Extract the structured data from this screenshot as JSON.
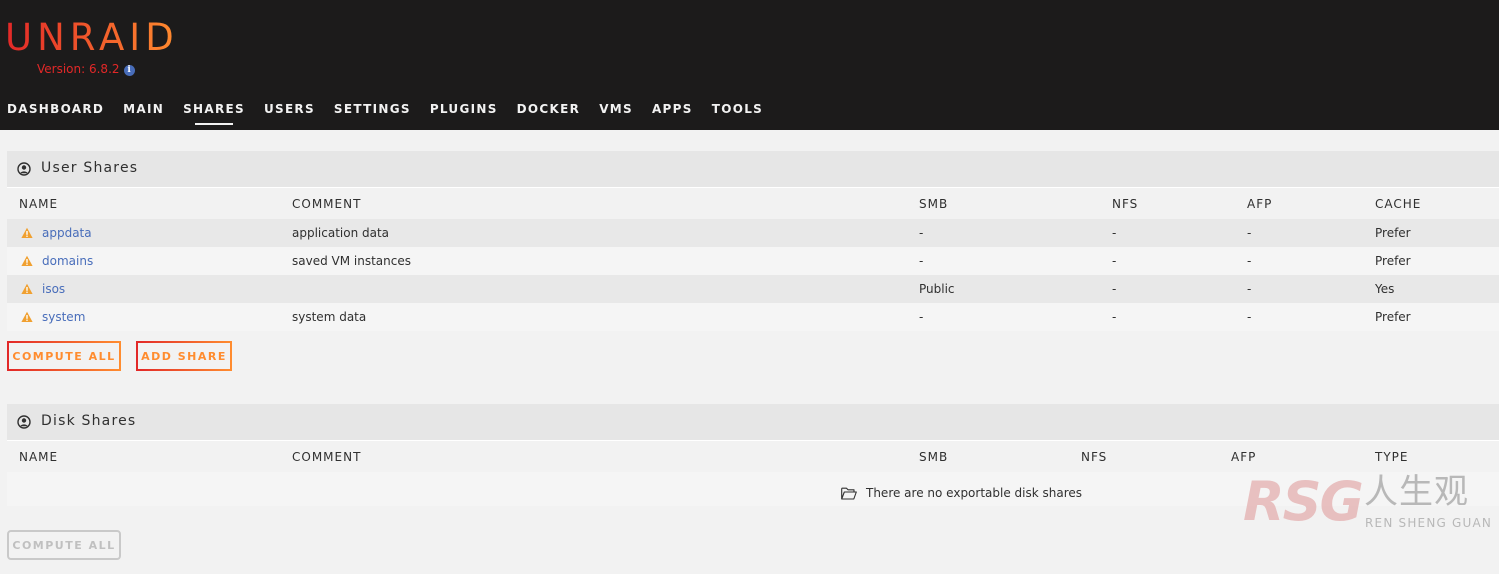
{
  "header": {
    "logo_text": "UNRAID",
    "version_text": "Version: 6.8.2",
    "info_icon": "i"
  },
  "nav": {
    "items": [
      "DASHBOARD",
      "MAIN",
      "SHARES",
      "USERS",
      "SETTINGS",
      "PLUGINS",
      "DOCKER",
      "VMS",
      "APPS",
      "TOOLS"
    ],
    "active": "SHARES"
  },
  "user_shares": {
    "title": "User Shares",
    "columns": [
      "NAME",
      "COMMENT",
      "SMB",
      "NFS",
      "AFP",
      "CACHE"
    ],
    "rows": [
      {
        "name": "appdata",
        "comment": "application data",
        "smb": "-",
        "nfs": "-",
        "afp": "-",
        "cache": "Prefer"
      },
      {
        "name": "domains",
        "comment": "saved VM instances",
        "smb": "-",
        "nfs": "-",
        "afp": "-",
        "cache": "Prefer"
      },
      {
        "name": "isos",
        "comment": "",
        "smb": "Public",
        "nfs": "-",
        "afp": "-",
        "cache": "Yes"
      },
      {
        "name": "system",
        "comment": "system data",
        "smb": "-",
        "nfs": "-",
        "afp": "-",
        "cache": "Prefer"
      }
    ],
    "compute_all_label": "COMPUTE ALL",
    "add_share_label": "ADD SHARE"
  },
  "disk_shares": {
    "title": "Disk Shares",
    "columns": [
      "NAME",
      "COMMENT",
      "SMB",
      "NFS",
      "AFP",
      "TYPE"
    ],
    "empty_message": "There are no exportable disk shares",
    "compute_all_label": "COMPUTE ALL"
  },
  "watermark": {
    "brand": "RSG",
    "chinese": "人生观",
    "english": "REN SHENG GUAN"
  },
  "colors": {
    "header_bg": "#1c1b1b",
    "brand_red": "#e22828",
    "brand_orange": "#ff8c2f",
    "link_blue": "#486dba",
    "warning": "#f0a030"
  }
}
